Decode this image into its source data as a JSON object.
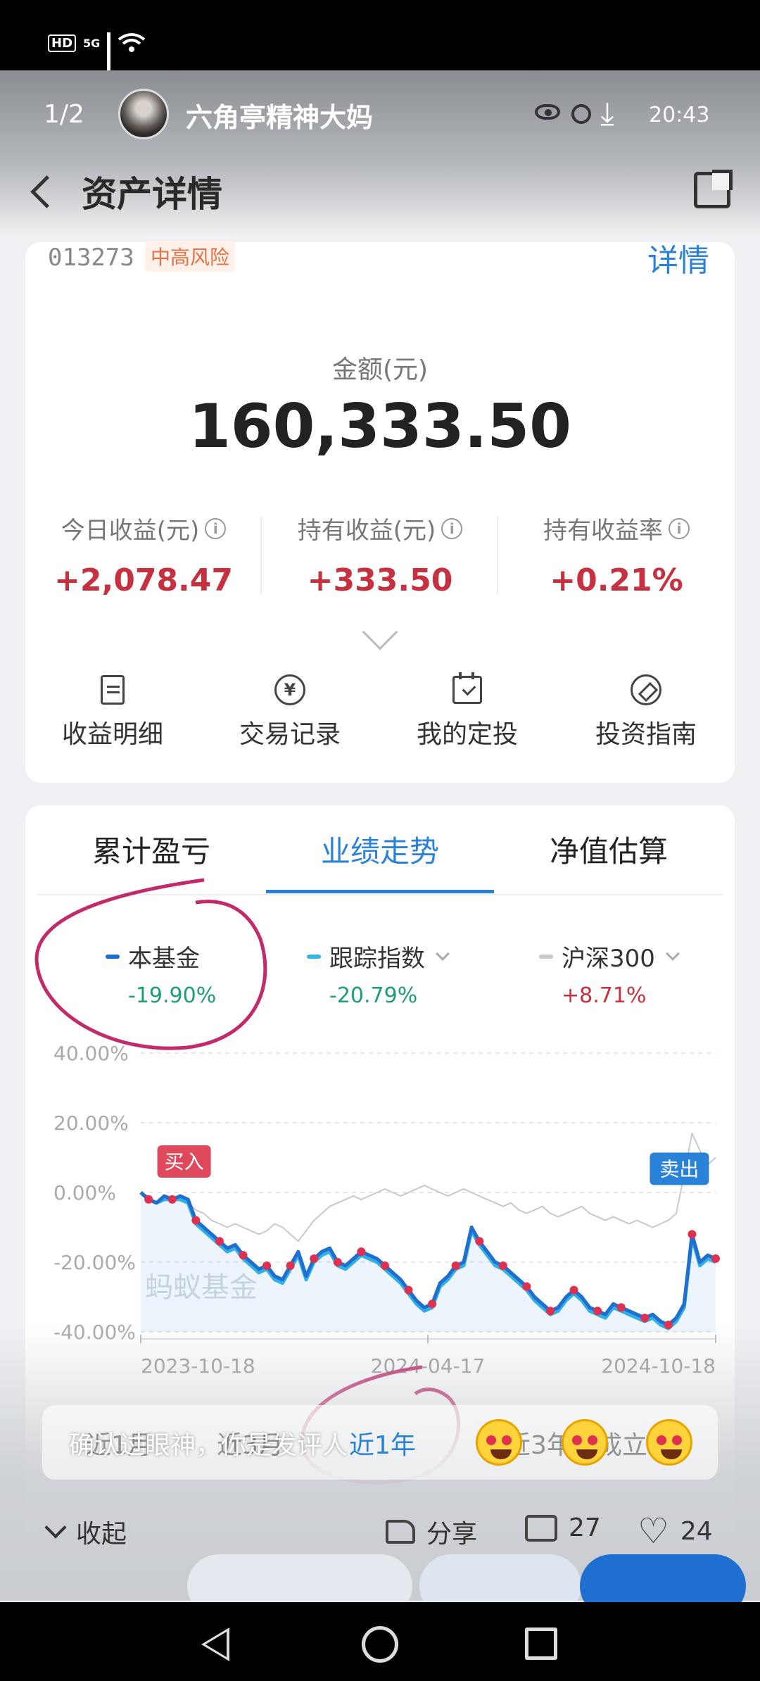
{
  "status": {
    "network": "5G",
    "hd": "HD"
  },
  "video": {
    "pager": "1/2",
    "username": "六角亭精神大妈",
    "time": "20:43"
  },
  "header": {
    "title": "资产详情"
  },
  "fund": {
    "code": "013273",
    "risk_badge": "中高风险",
    "detail_link": "详情",
    "amount_label": "金额(元)",
    "amount": "160,333.50",
    "stats": [
      {
        "label": "今日收益(元)",
        "value": "+2,078.47"
      },
      {
        "label": "持有收益(元)",
        "value": "+333.50"
      },
      {
        "label": "持有收益率",
        "value": "+0.21%"
      }
    ]
  },
  "actions": [
    {
      "label": "收益明细",
      "icon": "document-icon"
    },
    {
      "label": "交易记录",
      "icon": "yen-icon"
    },
    {
      "label": "我的定投",
      "icon": "calendar-check-icon"
    },
    {
      "label": "投资指南",
      "icon": "compass-icon"
    }
  ],
  "tabs": [
    {
      "label": "累计盈亏"
    },
    {
      "label": "业绩走势"
    },
    {
      "label": "净值估算"
    }
  ],
  "legend": [
    {
      "name": "本基金",
      "value": "-19.90%",
      "color": "#1f6fd1",
      "value_color": "#1e9e76"
    },
    {
      "name": "跟踪指数",
      "value": "-20.79%",
      "color": "#32b6e6",
      "value_color": "#1e9e76"
    },
    {
      "name": "沪深300",
      "value": "+8.71%",
      "color": "#c9c9c9",
      "value_color": "#c7313f"
    }
  ],
  "chart_data": {
    "type": "line",
    "y_ticks": [
      "40.00%",
      "20.00%",
      "0.00%",
      "-20.00%",
      "-40.00%"
    ],
    "ylim": [
      -40,
      40
    ],
    "x_ticks": [
      "2023-10-18",
      "2024-04-17",
      "2024-10-18"
    ],
    "watermark": "蚂蚁基金",
    "buy_label": "买入",
    "sell_label": "卖出",
    "series": [
      {
        "name": "本基金",
        "color": "#1f6fd1",
        "values": [
          0,
          -2,
          -3,
          -1,
          -2,
          -1,
          -2,
          -8,
          -10,
          -12,
          -14,
          -16,
          -15,
          -18,
          -20,
          -22,
          -21,
          -24,
          -25,
          -21,
          -17,
          -24,
          -19,
          -17,
          -16,
          -20,
          -21,
          -19,
          -17,
          -18,
          -19,
          -21,
          -23,
          -25,
          -28,
          -31,
          -33,
          -32,
          -26,
          -24,
          -21,
          -20,
          -10,
          -14,
          -17,
          -20,
          -21,
          -23,
          -25,
          -27,
          -30,
          -32,
          -34,
          -33,
          -30,
          -28,
          -30,
          -33,
          -34,
          -35,
          -32,
          -33,
          -34,
          -35,
          -36,
          -35,
          -37,
          -38,
          -36,
          -32,
          -12,
          -20,
          -18,
          -19
        ]
      },
      {
        "name": "跟踪指数",
        "color": "#32b6e6",
        "values": [
          0,
          -2,
          -3,
          -2,
          -2,
          -2,
          -3,
          -9,
          -11,
          -13,
          -15,
          -17,
          -16,
          -19,
          -21,
          -23,
          -22,
          -25,
          -26,
          -22,
          -18,
          -25,
          -20,
          -18,
          -17,
          -21,
          -22,
          -20,
          -18,
          -19,
          -20,
          -22,
          -24,
          -26,
          -29,
          -32,
          -34,
          -33,
          -27,
          -25,
          -22,
          -21,
          -11,
          -15,
          -18,
          -21,
          -22,
          -24,
          -26,
          -28,
          -31,
          -33,
          -35,
          -34,
          -31,
          -29,
          -31,
          -34,
          -35,
          -36,
          -33,
          -34,
          -35,
          -36,
          -37,
          -36,
          -38,
          -39,
          -37,
          -33,
          -13,
          -21,
          -19,
          -20
        ]
      },
      {
        "name": "沪深300",
        "color": "#c9c9c9",
        "values": [
          0,
          -1,
          -3,
          -2,
          -1,
          -2,
          -3,
          -5,
          -6,
          -8,
          -9,
          -10,
          -9,
          -10,
          -11,
          -12,
          -11,
          -9,
          -10,
          -12,
          -14,
          -11,
          -8,
          -6,
          -4,
          -3,
          -2,
          -1,
          -2,
          -1,
          0,
          1,
          0,
          -1,
          0,
          1,
          2,
          1,
          0,
          -1,
          0,
          1,
          0,
          -1,
          -2,
          -3,
          -4,
          -3,
          -5,
          -6,
          -5,
          -4,
          -6,
          -7,
          -6,
          -5,
          -4,
          -6,
          -7,
          -8,
          -7,
          -8,
          -9,
          -8,
          -9,
          -10,
          -9,
          -8,
          -6,
          5,
          17,
          12,
          8,
          10
        ]
      }
    ]
  },
  "ranges": {
    "r1": "近1月",
    "r2": "近3月",
    "r3": "近1年",
    "r4": "近3年",
    "r5": "成立来"
  },
  "danmu": "确认过眼神，你是发评人",
  "social": {
    "collapse": "收起",
    "share": "分享",
    "comments": "27",
    "likes": "24"
  }
}
